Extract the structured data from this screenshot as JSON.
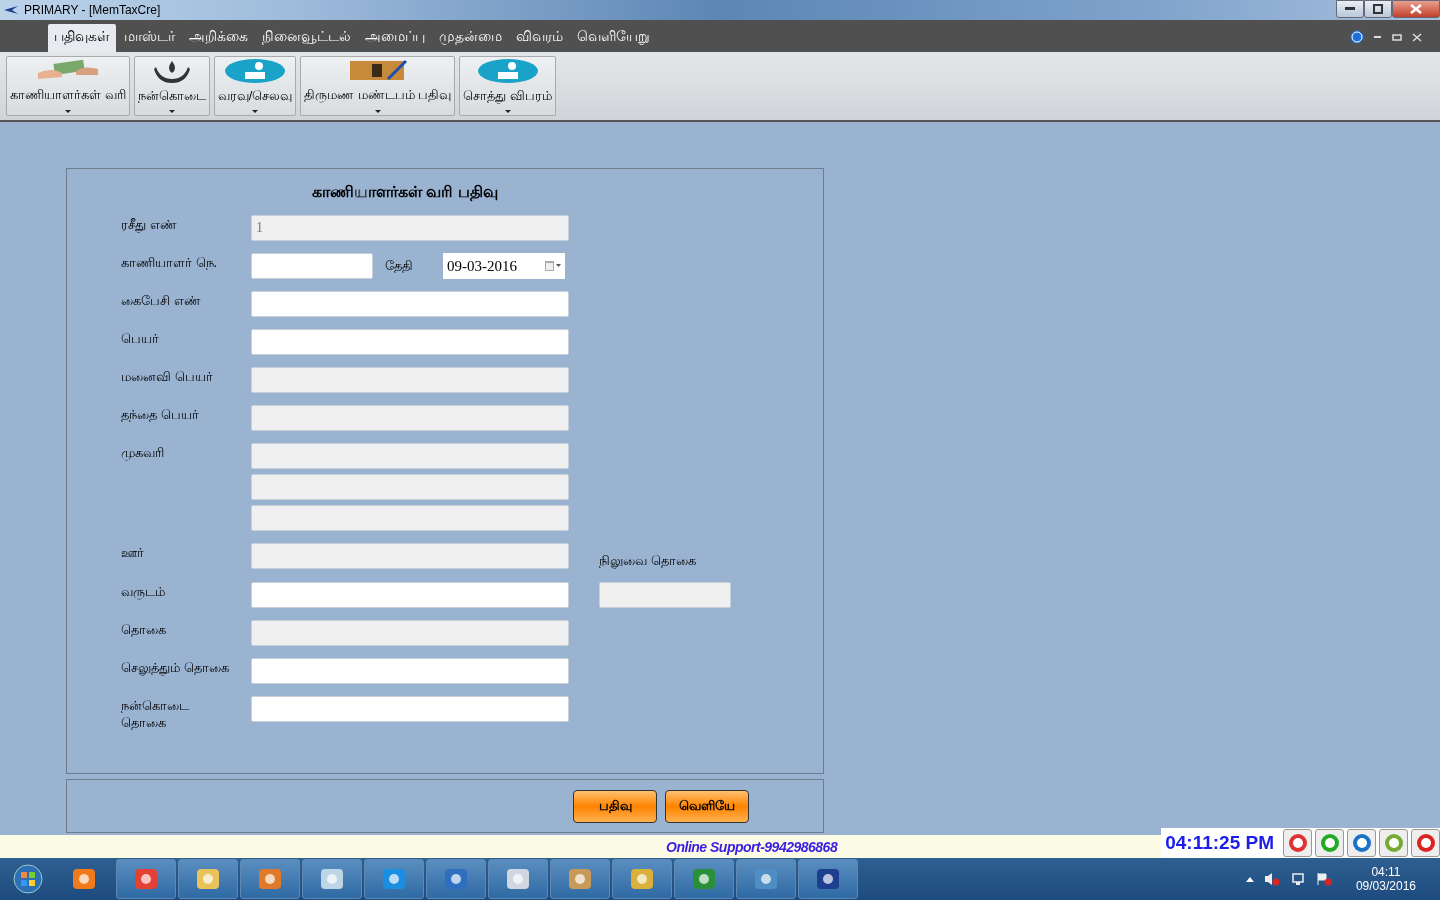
{
  "window": {
    "title": "PRIMARY - [MemTaxCre]"
  },
  "menu": [
    {
      "label": "பதிவுகள்",
      "selected": true
    },
    {
      "label": "மாஸ்டர்",
      "selected": false
    },
    {
      "label": "அறிக்கை",
      "selected": false
    },
    {
      "label": "நினைவூட்டல்",
      "selected": false
    },
    {
      "label": "அமைப்பு",
      "selected": false
    },
    {
      "label": "முதன்மை",
      "selected": false
    },
    {
      "label": "விவரம்",
      "selected": false
    },
    {
      "label": "வெளியேறு",
      "selected": false
    }
  ],
  "ribbon": [
    {
      "label": "காணியாளர்கள் வரி",
      "kind": "money"
    },
    {
      "label": "நன்கொடை",
      "kind": "hands"
    },
    {
      "label": "வரவு/செலவு",
      "kind": "coin"
    },
    {
      "label": "திருமண மண்டபம் பதிவு",
      "kind": "book"
    },
    {
      "label": "சொத்து விபரம்",
      "kind": "coin"
    }
  ],
  "form": {
    "title": "காணியாளர்கள் வரி பதிவு",
    "rows": [
      {
        "label": "ரசீது எண்",
        "fields": [
          {
            "value": "1",
            "disabled": true
          }
        ]
      },
      {
        "label": "காணியாளர் நெ.",
        "fields": [
          {
            "disabled": false
          }
        ],
        "date_label": "தேதி",
        "date_value": "09-03-2016"
      },
      {
        "label": "கைபேசி எண்",
        "fields": [
          {
            "disabled": false
          }
        ]
      },
      {
        "label": "பெயர்",
        "fields": [
          {
            "disabled": false
          }
        ]
      },
      {
        "label": "மனைவி பெயர்",
        "fields": [
          {
            "disabled": true
          }
        ]
      },
      {
        "label": "தந்தை பெயர்",
        "fields": [
          {
            "disabled": true
          }
        ]
      },
      {
        "label": "முகவரி",
        "fields": [
          {
            "disabled": true
          },
          {
            "disabled": true
          },
          {
            "disabled": true
          }
        ]
      },
      {
        "label": "ஊர்",
        "fields": [
          {
            "disabled": true
          }
        ],
        "side_label": "நிலுவை தொகை"
      },
      {
        "label": "வருடம்",
        "fields": [
          {
            "disabled": false
          }
        ],
        "side_field": {
          "disabled": true
        }
      },
      {
        "label": "தொகை",
        "fields": [
          {
            "disabled": true
          }
        ]
      },
      {
        "label": "செலுத்தும் தொகை",
        "fields": [
          {
            "disabled": false
          }
        ]
      },
      {
        "label": "நன்கொடை தொகை",
        "fields": [
          {
            "disabled": false
          }
        ]
      }
    ],
    "buttons": [
      "பதிவு",
      "வெளியே"
    ]
  },
  "status_bar": {
    "support": "Online Support-9942986868",
    "clock": "04:11:25 PM"
  },
  "taskbar": {
    "time": "04:11",
    "date": "09/03/2016"
  }
}
